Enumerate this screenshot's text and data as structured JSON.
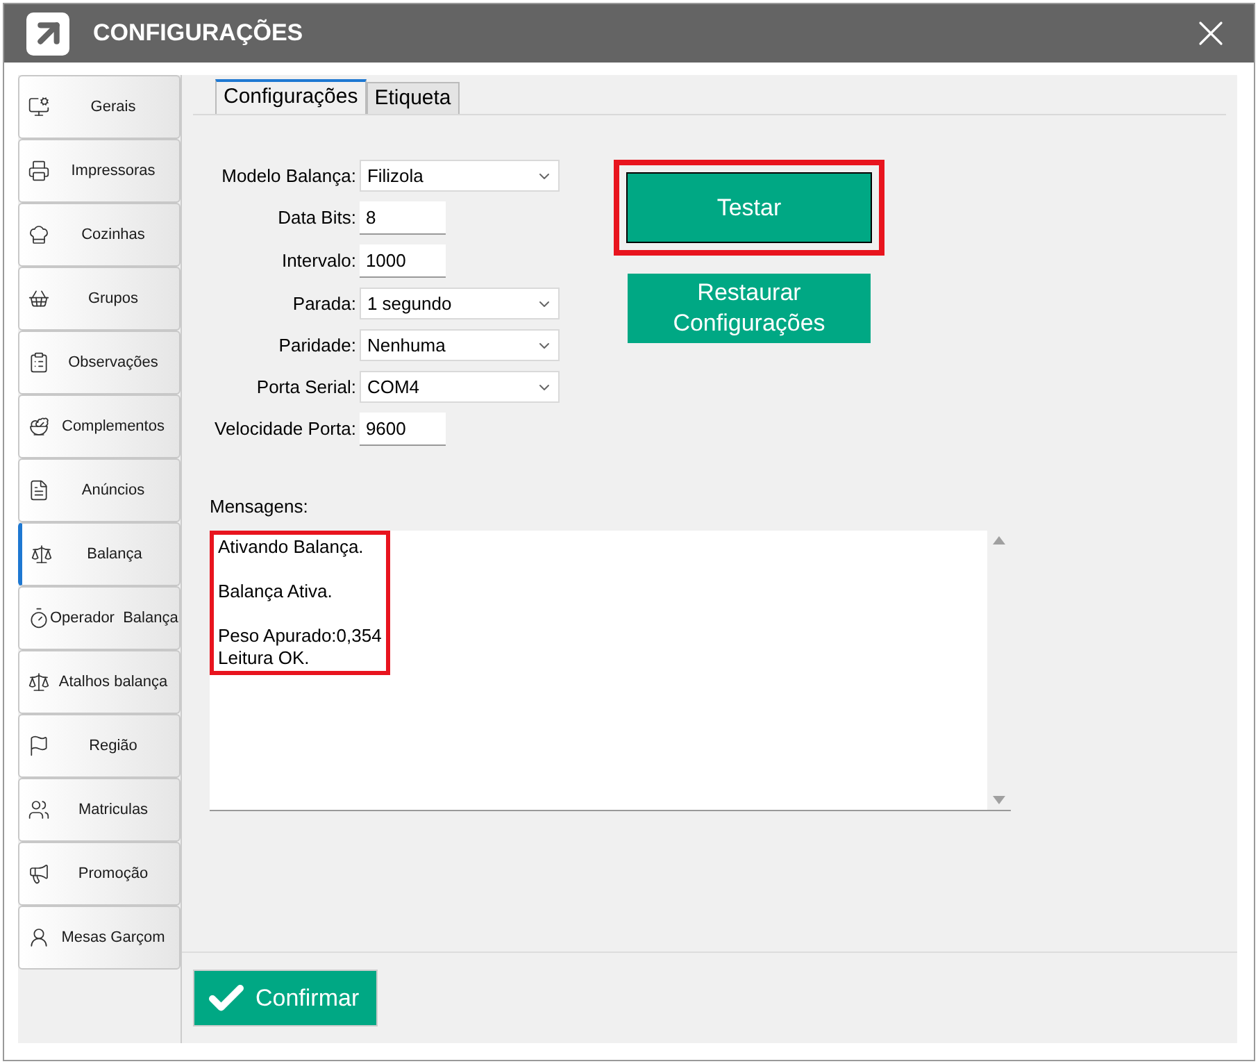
{
  "window": {
    "title": "CONFIGURAÇÕES"
  },
  "sidebar": {
    "items": [
      {
        "label": "Gerais",
        "selected": false
      },
      {
        "label": "Impressoras",
        "selected": false
      },
      {
        "label": "Cozinhas",
        "selected": false
      },
      {
        "label": "Grupos",
        "selected": false
      },
      {
        "label": "Observações",
        "selected": false
      },
      {
        "label": "Complementos",
        "selected": false
      },
      {
        "label": "Anúncios",
        "selected": false
      },
      {
        "label": "Balança",
        "selected": true
      },
      {
        "label": "Operador  Balança",
        "selected": false
      },
      {
        "label": "Atalhos balança",
        "selected": false
      },
      {
        "label": "Região",
        "selected": false
      },
      {
        "label": "Matriculas",
        "selected": false
      },
      {
        "label": "Promoção",
        "selected": false
      },
      {
        "label": "Mesas Garçom",
        "selected": false
      }
    ]
  },
  "tabs": [
    {
      "label": "Configurações",
      "selected": true
    },
    {
      "label": "Etiqueta",
      "selected": false
    }
  ],
  "form": [
    {
      "label": "Modelo Balança:",
      "kind": "select",
      "value": "Filizola"
    },
    {
      "label": "Data Bits:",
      "kind": "input",
      "value": "8"
    },
    {
      "label": "Intervalo:",
      "kind": "input",
      "value": "1000"
    },
    {
      "label": "Parada:",
      "kind": "select",
      "value": "1 segundo"
    },
    {
      "label": "Paridade:",
      "kind": "select",
      "value": "Nenhuma"
    },
    {
      "label": "Porta Serial:",
      "kind": "select",
      "value": "COM4"
    },
    {
      "label": "Velocidade Porta:",
      "kind": "input",
      "value": "9600"
    }
  ],
  "buttons": [
    {
      "label": "Testar",
      "highlighted": true
    },
    {
      "label": "Restaurar Configurações",
      "highlighted": false
    }
  ],
  "messages": {
    "label": "Mensagens:",
    "paragraphs": [
      [
        "Ativando Balança."
      ],
      [
        "Balança Ativa."
      ],
      [
        "Peso Apurado:0,354",
        "Leitura OK."
      ]
    ]
  },
  "confirm_button": {
    "label": "Confirmar"
  }
}
